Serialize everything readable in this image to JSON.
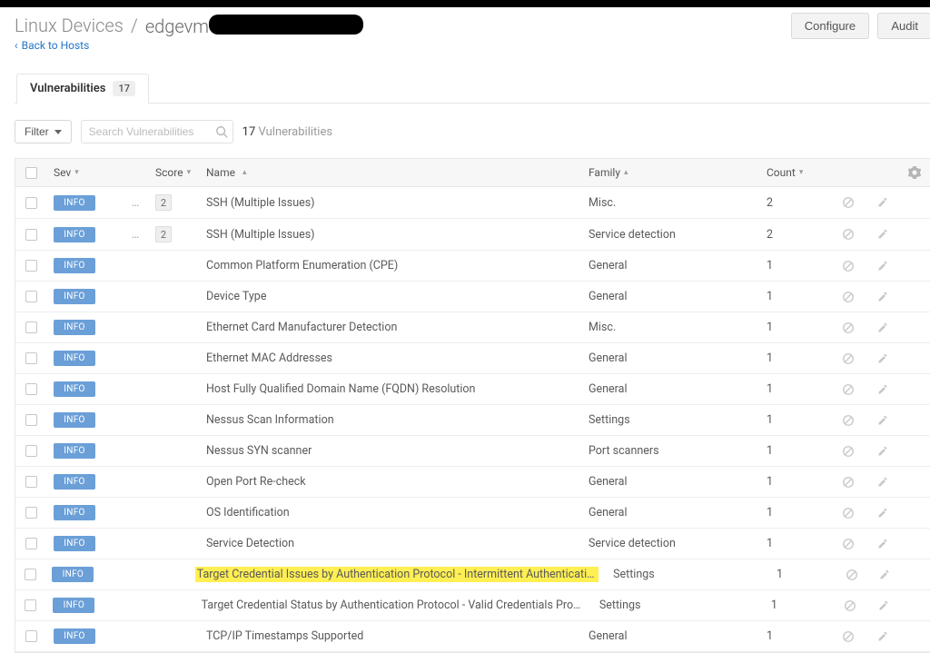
{
  "header": {
    "breadcrumb_root": "Linux Devices",
    "breadcrumb_sep": "/",
    "breadcrumb_leaf_prefix": "edgevm",
    "back_link_label": "Back to Hosts",
    "configure_label": "Configure",
    "audit_label": "Audit"
  },
  "tabs": {
    "active_label": "Vulnerabilities",
    "active_count": "17"
  },
  "toolbar": {
    "filter_label": "Filter",
    "search_placeholder": "Search Vulnerabilities",
    "counter_count": "17",
    "counter_label": "Vulnerabilities"
  },
  "columns": {
    "sev": "Sev",
    "score": "Score",
    "name": "Name",
    "family": "Family",
    "count": "Count"
  },
  "rows": [
    {
      "sev": "INFO",
      "score_badge": "2",
      "menu": true,
      "name": "SSH (Multiple Issues)",
      "family": "Misc.",
      "count": "2",
      "highlight": false
    },
    {
      "sev": "INFO",
      "score_badge": "2",
      "menu": true,
      "name": "SSH (Multiple Issues)",
      "family": "Service detection",
      "count": "2",
      "highlight": false
    },
    {
      "sev": "INFO",
      "score_badge": "",
      "menu": false,
      "name": "Common Platform Enumeration (CPE)",
      "family": "General",
      "count": "1",
      "highlight": false
    },
    {
      "sev": "INFO",
      "score_badge": "",
      "menu": false,
      "name": "Device Type",
      "family": "General",
      "count": "1",
      "highlight": false
    },
    {
      "sev": "INFO",
      "score_badge": "",
      "menu": false,
      "name": "Ethernet Card Manufacturer Detection",
      "family": "Misc.",
      "count": "1",
      "highlight": false
    },
    {
      "sev": "INFO",
      "score_badge": "",
      "menu": false,
      "name": "Ethernet MAC Addresses",
      "family": "General",
      "count": "1",
      "highlight": false
    },
    {
      "sev": "INFO",
      "score_badge": "",
      "menu": false,
      "name": "Host Fully Qualified Domain Name (FQDN) Resolution",
      "family": "General",
      "count": "1",
      "highlight": false
    },
    {
      "sev": "INFO",
      "score_badge": "",
      "menu": false,
      "name": "Nessus Scan Information",
      "family": "Settings",
      "count": "1",
      "highlight": false
    },
    {
      "sev": "INFO",
      "score_badge": "",
      "menu": false,
      "name": "Nessus SYN scanner",
      "family": "Port scanners",
      "count": "1",
      "highlight": false
    },
    {
      "sev": "INFO",
      "score_badge": "",
      "menu": false,
      "name": "Open Port Re-check",
      "family": "General",
      "count": "1",
      "highlight": false
    },
    {
      "sev": "INFO",
      "score_badge": "",
      "menu": false,
      "name": "OS Identification",
      "family": "General",
      "count": "1",
      "highlight": false
    },
    {
      "sev": "INFO",
      "score_badge": "",
      "menu": false,
      "name": "Service Detection",
      "family": "Service detection",
      "count": "1",
      "highlight": false
    },
    {
      "sev": "INFO",
      "score_badge": "",
      "menu": false,
      "name": "Target Credential Issues by Authentication Protocol - Intermittent Authentication Failure",
      "family": "Settings",
      "count": "1",
      "highlight": true
    },
    {
      "sev": "INFO",
      "score_badge": "",
      "menu": false,
      "name": "Target Credential Status by Authentication Protocol - Valid Credentials Provided",
      "family": "Settings",
      "count": "1",
      "highlight": false
    },
    {
      "sev": "INFO",
      "score_badge": "",
      "menu": false,
      "name": "TCP/IP Timestamps Supported",
      "family": "General",
      "count": "1",
      "highlight": false
    }
  ]
}
